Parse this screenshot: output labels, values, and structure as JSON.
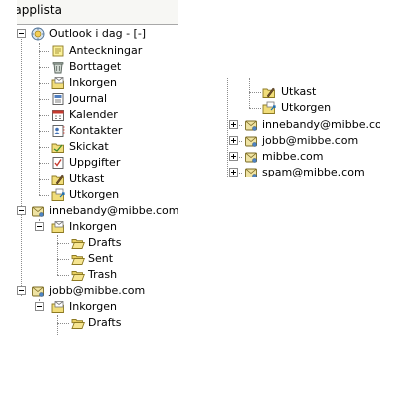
{
  "left_pane": {
    "title": "Mapplista",
    "tree": {
      "outlook_today": {
        "label": "Outlook i dag - [-]",
        "children": [
          "Anteckningar",
          "Borttaget",
          "Inkorgen",
          "Journal",
          "Kalender",
          "Kontakter",
          "Skickat",
          "Uppgifter",
          "Utkast",
          "Utkorgen"
        ]
      },
      "innebandy": {
        "label": "innebandy@mibbe.com",
        "inbox": "Inkorgen",
        "subfolders": [
          "Drafts",
          "Sent",
          "Trash"
        ]
      },
      "jobb": {
        "label": "jobb@mibbe.com",
        "inbox": "Inkorgen",
        "subfolders": [
          "Drafts"
        ]
      }
    }
  },
  "right_pane": {
    "items": [
      "Utkast",
      "Utkorgen"
    ],
    "accounts": [
      "innebandy@mibbe.com",
      "jobb@mibbe.com",
      "mibbe.com",
      "spam@mibbe.com"
    ]
  }
}
